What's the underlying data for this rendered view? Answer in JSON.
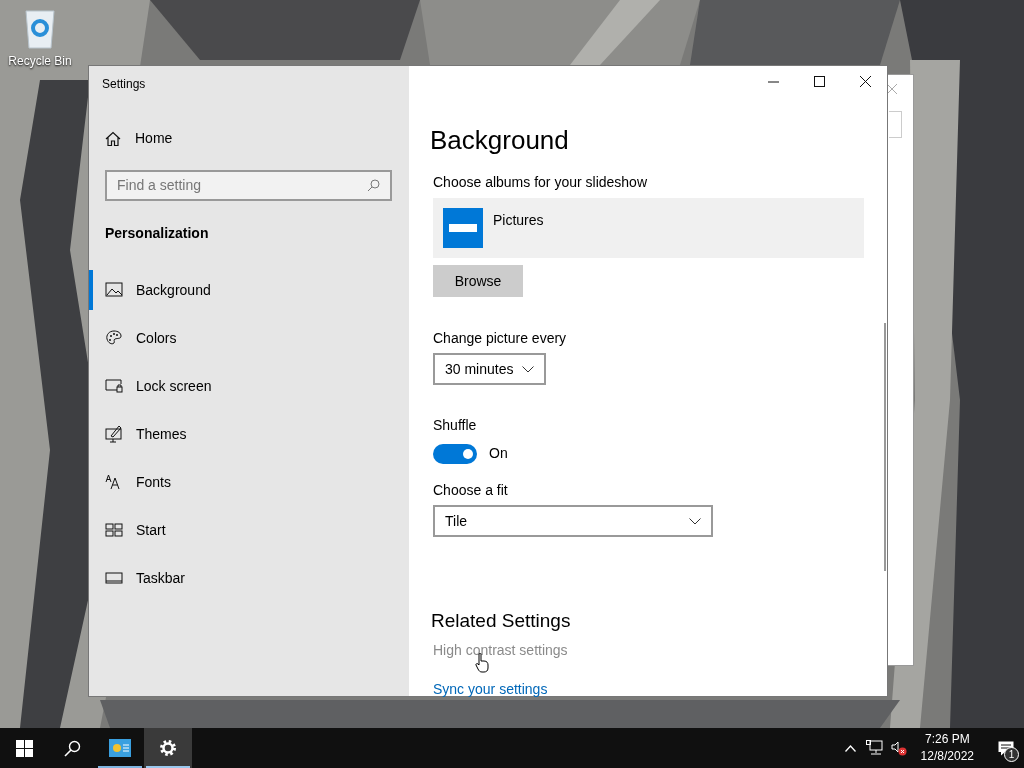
{
  "desktop": {
    "icons": [
      {
        "label": "Recycle Bin"
      }
    ]
  },
  "window": {
    "title": "Settings",
    "home": "Home",
    "search": {
      "placeholder": "Find a setting"
    },
    "section": "Personalization",
    "nav": [
      {
        "label": "Background",
        "kind": "background",
        "selected": true
      },
      {
        "label": "Colors",
        "kind": "colors",
        "selected": false
      },
      {
        "label": "Lock screen",
        "kind": "lock",
        "selected": false
      },
      {
        "label": "Themes",
        "kind": "themes",
        "selected": false
      },
      {
        "label": "Fonts",
        "kind": "fonts",
        "selected": false
      },
      {
        "label": "Start",
        "kind": "start",
        "selected": false
      },
      {
        "label": "Taskbar",
        "kind": "taskbar",
        "selected": false
      }
    ]
  },
  "page": {
    "heading": "Background",
    "albums_label": "Choose albums for your slideshow",
    "album": "Pictures",
    "browse": "Browse",
    "interval_label": "Change picture every",
    "interval": "30 minutes",
    "shuffle_label": "Shuffle",
    "shuffle": {
      "on": true,
      "label": "On"
    },
    "fit_label": "Choose a fit",
    "fit": "Tile",
    "related_heading": "Related Settings",
    "links": [
      {
        "label": "High contrast settings",
        "hovered": true
      },
      {
        "label": "Sync your settings",
        "hovered": false
      }
    ]
  },
  "taskbar": {
    "apps": [
      {
        "kind": "control-panel",
        "selected": false
      },
      {
        "kind": "settings",
        "selected": true
      }
    ],
    "clock": {
      "time": "7:26 PM",
      "date": "12/8/2022"
    },
    "notifications": "1"
  }
}
